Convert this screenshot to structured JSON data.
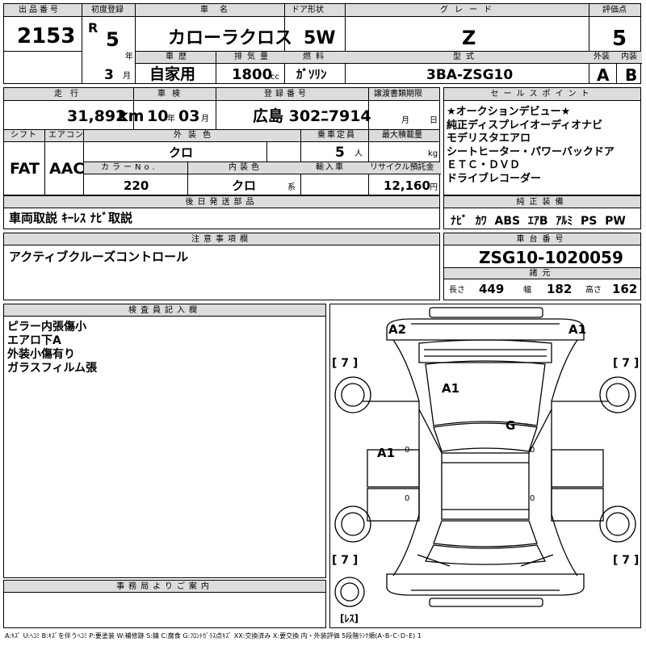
{
  "top": {
    "headers": {
      "lot": "出品番号",
      "first_reg": "初度登録",
      "car_name": "車名",
      "door": "ドア形状",
      "grade": "グレード",
      "score": "評価点"
    },
    "lot_number": "2153",
    "era": "R",
    "year": "5",
    "year_unit": "年",
    "month": "3",
    "month_unit": "月",
    "car_name": "カローラクロス",
    "door": "5W",
    "grade": "Z",
    "score": "5",
    "sub_headers": {
      "history": "車歴",
      "displacement": "排気量",
      "fuel": "燃料",
      "model": "型式",
      "exterior": "外装",
      "interior": "内装"
    },
    "history": "自家用",
    "displacement": "1800",
    "displacement_unit": "cc",
    "fuel": "ｶﾞｿﾘﾝ",
    "model": "3BA-ZSG10",
    "exterior_grade": "A",
    "interior_grade": "B"
  },
  "middle": {
    "headers": {
      "mileage": "走行",
      "inspection": "車検",
      "plate": "登録番号",
      "transfer": "譲渡書類期限",
      "shift": "シフト",
      "aircon": "エアコン",
      "ext_color": "外装色",
      "capacity": "乗車定員",
      "max_load": "最大積載量",
      "color_no": "カラーNo.",
      "int_color": "内装色",
      "import": "輸入車",
      "recycle": "リサイクル預託金"
    },
    "mileage": "31,892",
    "mileage_unit": "km",
    "inspection_year": "10",
    "inspection_year_unit": "年",
    "inspection_month": "03",
    "inspection_month_unit": "月",
    "plate": "広島 302ﾆ7914",
    "transfer_month_unit": "月",
    "transfer_day_unit": "日",
    "shift": "FAT",
    "aircon": "AAC",
    "ext_color": "クロ",
    "capacity": "5",
    "capacity_unit": "人",
    "max_load_unit": "kg",
    "color_no": "220",
    "int_color": "クロ",
    "int_color_unit": "系",
    "recycle": "12,160",
    "recycle_unit": "円"
  },
  "sales_points": {
    "header": "セールスポイント",
    "lines": [
      "★オークションデビュー★",
      "純正ディスプレイオーディオナビ",
      "モデリスタエアロ",
      "シートヒーター・パワーバックドア",
      "ＥＴＣ・ＤＶＤ",
      "ドライブレコーダー"
    ]
  },
  "rear_parts": {
    "header": "後日発送部品",
    "text": "車両取説 ｷｰﾚｽ ﾅﾋﾞ取説"
  },
  "equipment": {
    "header": "純正装備",
    "items": [
      "ﾅﾋﾞ",
      "ｶﾜ",
      "ABS",
      "ｴｱB",
      "ｱﾙﾐ",
      "PS",
      "PW"
    ]
  },
  "caution": {
    "header": "注意事項欄",
    "text": "アクティブクルーズコントロール"
  },
  "chassis": {
    "header": "車台番号",
    "number": "ZSG10-1020059"
  },
  "specs": {
    "header": "諸元",
    "length_label": "長さ",
    "length": "449",
    "width_label": "幅",
    "width": "182",
    "height_label": "高さ",
    "height": "162"
  },
  "inspector": {
    "header": "検査員記入欄",
    "lines": [
      "ピラー内張傷小",
      "エアロ下A",
      "外装小傷有り",
      "ガラスフィルム張"
    ]
  },
  "diagram": {
    "marks": {
      "front_left": "A2",
      "front_right": "A1",
      "hood": "A1",
      "roof": "G",
      "left_side": "A1"
    },
    "tread_label": "[ 7 ]",
    "spare_label": "[ﾚｽ]",
    "door_marks": "0"
  },
  "office": {
    "header": "事務局よりご案内",
    "text": ""
  },
  "legend": "A:ｷｽﾞ U:ﾍｺﾐ B:ｷｽﾞを伴うﾍｺﾐ P:要塗装 W:補修跡 S:錆 C:腐食 G:ﾌﾛﾝﾄｶﾞﾗｽ点ｷｽﾞ XX:交換済み X:要交換 内・外装評価 5段階ﾗﾝｸ順(A･B･C･D･E) 1"
}
